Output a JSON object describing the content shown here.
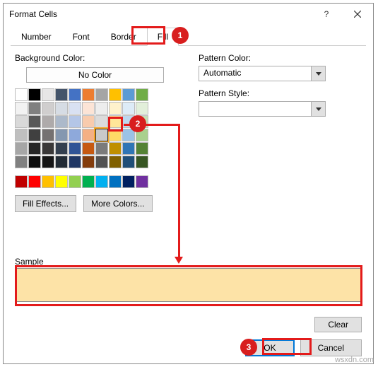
{
  "title": "Format Cells",
  "tabs": {
    "number": "Number",
    "font": "Font",
    "border": "Border",
    "fill": "Fill",
    "active": "Fill"
  },
  "left": {
    "bg_label": "Background Color:",
    "no_color": "No Color",
    "fill_effects": "Fill Effects...",
    "more_colors": "More Colors..."
  },
  "right": {
    "pattern_color_label": "Pattern Color:",
    "pattern_color_value": "Automatic",
    "pattern_style_label": "Pattern Style:"
  },
  "sample": {
    "label": "Sample",
    "color": "#fde3a7"
  },
  "buttons": {
    "clear": "Clear",
    "ok": "OK",
    "cancel": "Cancel"
  },
  "badges": {
    "b1": "1",
    "b2": "2",
    "b3": "3"
  },
  "watermark": "wsxdn.com",
  "palette_theme": [
    "#ffffff",
    "#000000",
    "#e7e6e6",
    "#44546a",
    "#4472c4",
    "#ed7d31",
    "#a5a5a5",
    "#ffc000",
    "#5b9bd5",
    "#70ad47",
    "#f2f2f2",
    "#808080",
    "#d0cece",
    "#d6dce4",
    "#d9e1f2",
    "#fce4d6",
    "#ededed",
    "#fff2cc",
    "#ddebf7",
    "#e2efda",
    "#d9d9d9",
    "#595959",
    "#aeaaaa",
    "#acb9ca",
    "#b4c6e7",
    "#f8cbad",
    "#dbdbdb",
    "#ffe699",
    "#bdd7ee",
    "#c6e0b4",
    "#bfbfbf",
    "#404040",
    "#757171",
    "#8497b0",
    "#8ea9db",
    "#f4b084",
    "#c9c9c9",
    "#ffd966",
    "#9bc2e6",
    "#a9d08e",
    "#a6a6a6",
    "#262626",
    "#3a3838",
    "#333f4f",
    "#305496",
    "#c65911",
    "#7b7b7b",
    "#bf8f00",
    "#2f75b5",
    "#548235",
    "#808080",
    "#0d0d0d",
    "#161616",
    "#222b35",
    "#203764",
    "#833c0c",
    "#525252",
    "#806000",
    "#1f4e78",
    "#375623"
  ],
  "palette_std": [
    "#c00000",
    "#ff0000",
    "#ffc000",
    "#ffff00",
    "#92d050",
    "#00b050",
    "#00b0f0",
    "#0070c0",
    "#002060",
    "#7030a0"
  ],
  "selected_swatch_index": 36
}
